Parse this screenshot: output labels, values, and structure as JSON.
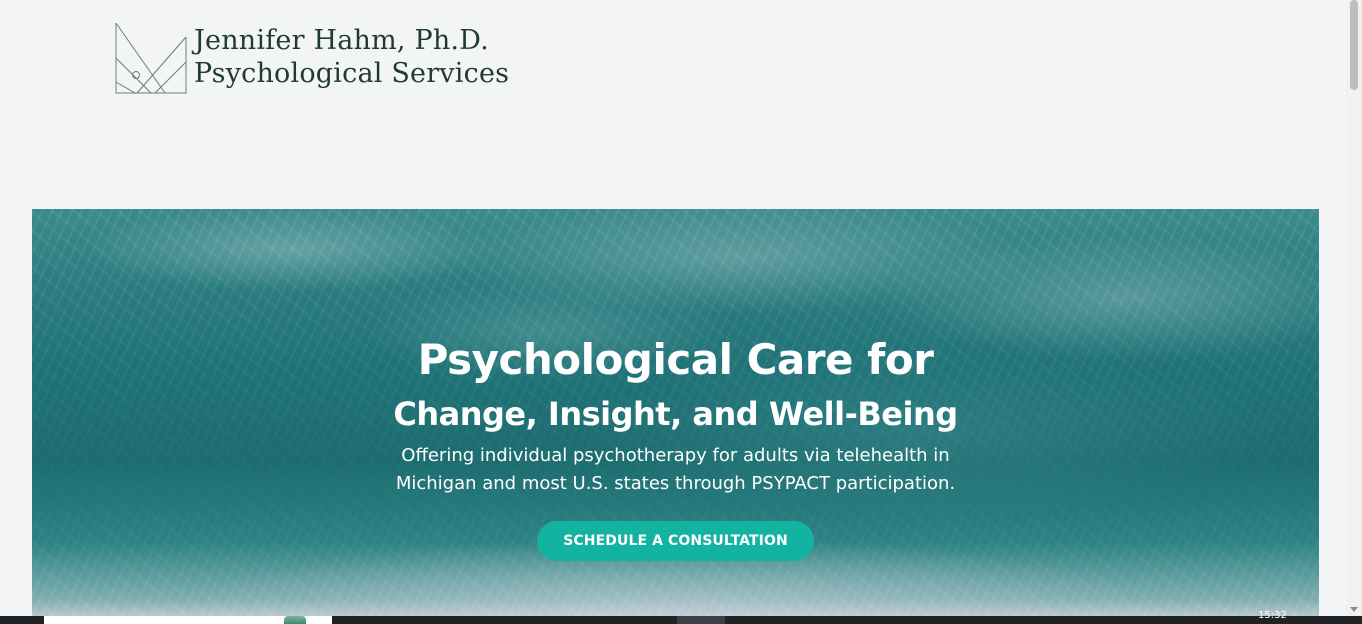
{
  "header": {
    "brand_line1": "Jennifer Hahm, Ph.D.",
    "brand_line2": "Psychological Services",
    "logo_icon": "crown-monogram-icon"
  },
  "hero": {
    "title": "Psychological Care for",
    "subtitle": "Change, Insight, and Well-Being",
    "description": "Offering individual psychotherapy for adults via telehealth in Michigan and most U.S. states through PSYPACT participation.",
    "cta_label": "SCHEDULE A CONSULTATION",
    "cta_color": "#12b3a0",
    "background": "ocean-waves-aerial-image"
  },
  "taskbar": {
    "clock": "15:32"
  }
}
